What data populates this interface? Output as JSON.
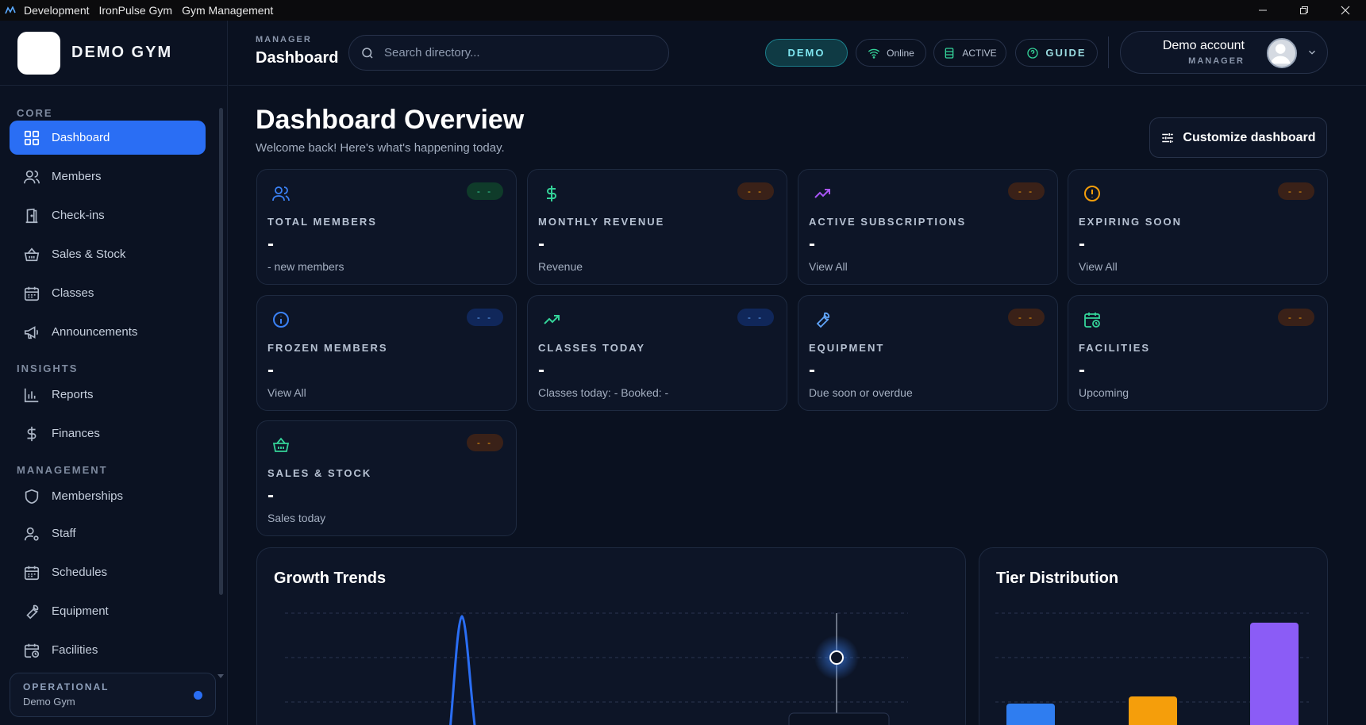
{
  "titlebar": {
    "items": [
      "Development",
      "IronPulse Gym",
      "Gym Management"
    ]
  },
  "brand": {
    "name": "DEMO GYM"
  },
  "sidebar": {
    "sections": [
      {
        "title": "CORE",
        "items": [
          {
            "label": "Dashboard",
            "icon": "grid-icon",
            "active": true
          },
          {
            "label": "Members",
            "icon": "users-icon"
          },
          {
            "label": "Check-ins",
            "icon": "door-icon"
          },
          {
            "label": "Sales & Stock",
            "icon": "basket-icon"
          },
          {
            "label": "Classes",
            "icon": "calendar-icon"
          },
          {
            "label": "Announcements",
            "icon": "megaphone-icon"
          }
        ]
      },
      {
        "title": "INSIGHTS",
        "items": [
          {
            "label": "Reports",
            "icon": "bar-chart-icon"
          },
          {
            "label": "Finances",
            "icon": "dollar-icon"
          }
        ]
      },
      {
        "title": "MANAGEMENT",
        "items": [
          {
            "label": "Memberships",
            "icon": "shield-icon"
          },
          {
            "label": "Staff",
            "icon": "user-gear-icon"
          },
          {
            "label": "Schedules",
            "icon": "calendar-icon"
          },
          {
            "label": "Equipment",
            "icon": "wrench-icon"
          },
          {
            "label": "Facilities",
            "icon": "calendar-clock-icon"
          }
        ]
      }
    ],
    "status": {
      "title": "OPERATIONAL",
      "subtitle": "Demo Gym",
      "dot_color": "#2a6ef4"
    }
  },
  "header": {
    "crumb_small": "MANAGER",
    "crumb_title": "Dashboard",
    "search_placeholder": "Search directory...",
    "demo_label": "DEMO",
    "online_label": "Online",
    "active_label": "ACTIVE",
    "guide_label": "GUIDE",
    "account_name": "Demo account",
    "account_role": "MANAGER"
  },
  "main": {
    "title": "Dashboard Overview",
    "subtitle": "Welcome back! Here's what's happening today.",
    "customize_label": "Customize dashboard"
  },
  "stats": [
    {
      "label": "TOTAL MEMBERS",
      "value": "-",
      "sub": "- new members",
      "badge": "- -",
      "icon": "users-icon",
      "icon_color": "#3b82f6",
      "badge_bg": "#0f3b2a",
      "badge_fg": "#34d399"
    },
    {
      "label": "MONTHLY REVENUE",
      "value": "-",
      "sub": "Revenue",
      "badge": "- -",
      "icon": "dollar-icon",
      "icon_color": "#34d399",
      "badge_bg": "#3a2118",
      "badge_fg": "#f59e0b"
    },
    {
      "label": "ACTIVE SUBSCRIPTIONS",
      "value": "-",
      "sub": "View All",
      "badge": "- -",
      "icon": "trending-up-icon",
      "icon_color": "#a855f7",
      "badge_bg": "#3a2118",
      "badge_fg": "#f59e0b"
    },
    {
      "label": "EXPIRING SOON",
      "value": "-",
      "sub": "View All",
      "badge": "- -",
      "icon": "alert-circle-icon",
      "icon_color": "#f59e0b",
      "badge_bg": "#3a2118",
      "badge_fg": "#f59e0b"
    },
    {
      "label": "FROZEN MEMBERS",
      "value": "-",
      "sub": "View All",
      "badge": "- -",
      "icon": "info-icon",
      "icon_color": "#3b82f6",
      "badge_bg": "#10275a",
      "badge_fg": "#60a5fa"
    },
    {
      "label": "CLASSES TODAY",
      "value": "-",
      "sub": "Classes today: - Booked: -",
      "badge": "- -",
      "icon": "trending-up-icon",
      "icon_color": "#34d399",
      "badge_bg": "#10275a",
      "badge_fg": "#60a5fa"
    },
    {
      "label": "EQUIPMENT",
      "value": "-",
      "sub": "Due soon or overdue",
      "badge": "- -",
      "icon": "wrench-icon",
      "icon_color": "#60a5fa",
      "badge_bg": "#3a2118",
      "badge_fg": "#f59e0b"
    },
    {
      "label": "FACILITIES",
      "value": "-",
      "sub": "Upcoming",
      "badge": "- -",
      "icon": "calendar-clock-icon",
      "icon_color": "#34d399",
      "badge_bg": "#3a2118",
      "badge_fg": "#f59e0b"
    },
    {
      "label": "SALES & STOCK",
      "value": "-",
      "sub": "Sales today",
      "badge": "- -",
      "icon": "basket-icon",
      "icon_color": "#34d399",
      "badge_bg": "#3a2118",
      "badge_fg": "#f59e0b"
    }
  ],
  "panels": {
    "growth_title": "Growth Trends",
    "tier_title": "Tier Distribution"
  },
  "colors": {
    "accent": "#2a6ef4",
    "tier_bars": [
      "#2f7df0",
      "#f59e0b",
      "#8b5cf6"
    ]
  }
}
